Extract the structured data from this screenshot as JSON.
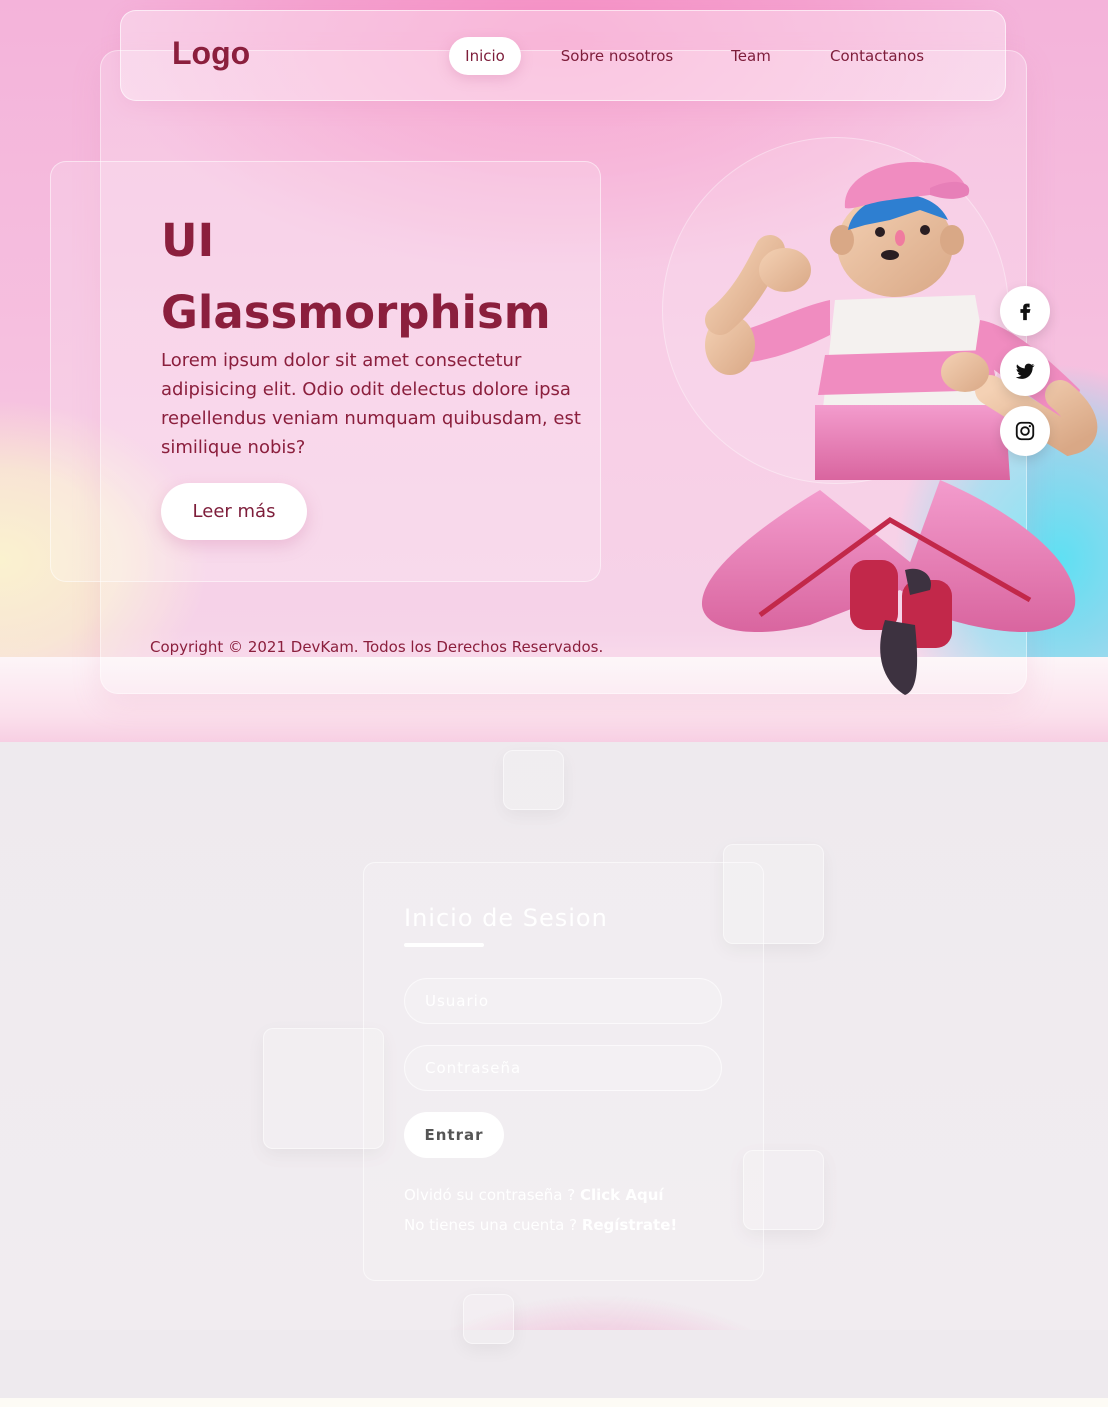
{
  "nav": {
    "logo": "Logo",
    "items": [
      {
        "label": "Inicio",
        "active": true
      },
      {
        "label": "Sobre nosotros",
        "active": false
      },
      {
        "label": "Team",
        "active": false
      },
      {
        "label": "Contactanos",
        "active": false
      }
    ]
  },
  "hero": {
    "title": "UI Glassmorphism",
    "text": "Lorem ipsum dolor sit amet consectetur adipisicing elit. Odio odit delectus dolore ipsa repellendus veniam numquam quibusdam, est similique nobis?",
    "button_label": "Leer más",
    "copyright": "Copyright © 2021 DevKam. Todos los Derechos Reservados."
  },
  "social": [
    {
      "icon": "facebook-icon"
    },
    {
      "icon": "twitter-icon"
    },
    {
      "icon": "instagram-icon"
    }
  ],
  "login": {
    "title": "Inicio de Sesion",
    "username_placeholder": "Usuario",
    "password_placeholder": "Contraseña",
    "submit_label": "Entrar",
    "forgot_text": "Olvidó su contraseña ?",
    "forgot_link": "Click Aquí",
    "register_text": "No tienes una cuenta ?",
    "register_link": "Regístrate!"
  },
  "colors": {
    "accent": "#8b1f3d",
    "hero_pink": "#f4b3da",
    "white": "#ffffff"
  }
}
